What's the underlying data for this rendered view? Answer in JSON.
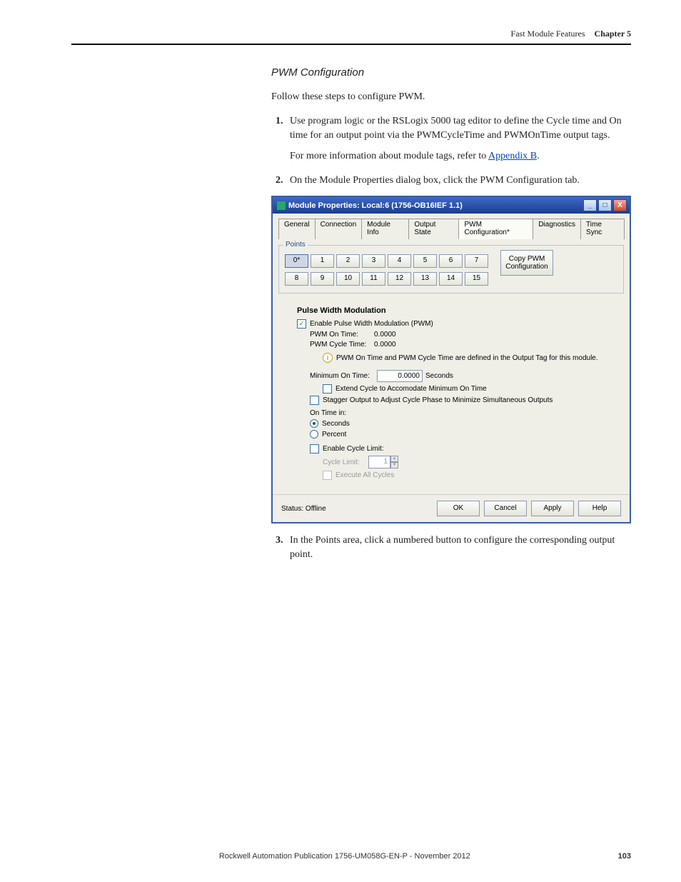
{
  "header": {
    "title": "Fast Module Features",
    "chapter": "Chapter 5"
  },
  "section_title": "PWM Configuration",
  "intro": "Follow these steps to configure PWM.",
  "steps": {
    "one": "Use program logic or the RSLogix 5000 tag editor to define the Cycle time and On time for an output point via the PWMCycleTime and PWMOnTime output tags.",
    "one_sub_a": "For more information about module tags, refer to ",
    "one_sub_link": "Appendix B",
    "one_sub_b": ".",
    "two": "On the Module Properties dialog box, click the PWM Configuration tab.",
    "three": "In the Points area, click a numbered button to configure the corresponding output point."
  },
  "dialog": {
    "title": "Module Properties: Local:6 (1756-OB16IEF 1.1)",
    "tabs": [
      "General",
      "Connection",
      "Module Info",
      "Output State",
      "PWM Configuration*",
      "Diagnostics",
      "Time Sync"
    ],
    "active_tab": 4,
    "points_label": "Points",
    "points_row1": [
      "0*",
      "1",
      "2",
      "3",
      "4",
      "5",
      "6",
      "7"
    ],
    "points_row2": [
      "8",
      "9",
      "10",
      "11",
      "12",
      "13",
      "14",
      "15"
    ],
    "copy_l1": "Copy PWM",
    "copy_l2": "Configuration",
    "section": "Pulse Width Modulation",
    "enable_pwm": "Enable Pulse Width Modulation (PWM)",
    "on_time_lbl": "PWM On Time:",
    "on_time_val": "0.0000",
    "cycle_time_lbl": "PWM Cycle Time:",
    "cycle_time_val": "0.0000",
    "info_text": "PWM On Time and PWM Cycle Time are defined in the Output Tag for this module.",
    "min_on_lbl": "Minimum On Time:",
    "min_on_val": "0.0000",
    "min_on_unit": "Seconds",
    "extend_cycle": "Extend Cycle to Accomodate Minimum On Time",
    "stagger": "Stagger Output to Adjust Cycle Phase to Minimize Simultaneous  Outputs",
    "on_time_in": "On Time in:",
    "seconds": "Seconds",
    "percent": "Percent",
    "enable_cycle_limit": "Enable Cycle Limit:",
    "cycle_limit_lbl": "Cycle Limit:",
    "cycle_limit_val": "1",
    "exec_all": "Execute All Cycles",
    "status_lbl": "Status:",
    "status_val": "Offline",
    "buttons": {
      "ok": "OK",
      "cancel": "Cancel",
      "apply": "Apply",
      "help": "Help"
    }
  },
  "footer": {
    "pub": "Rockwell Automation Publication 1756-UM058G-EN-P - November 2012",
    "page": "103"
  }
}
